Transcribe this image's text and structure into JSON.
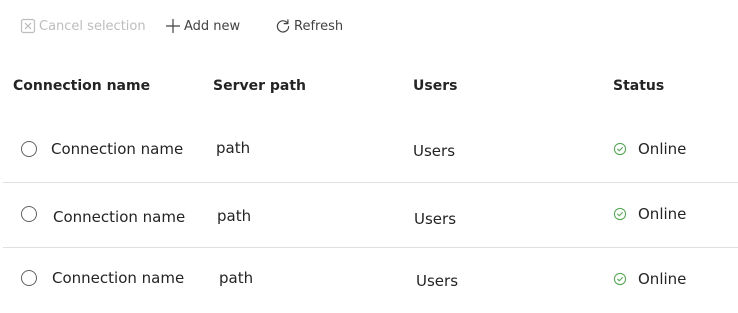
{
  "toolbar": {
    "cancel_label": "Cancel selection",
    "add_label": "Add new",
    "refresh_label": "Refresh"
  },
  "table": {
    "columns": [
      "Connection name",
      "Server path",
      "Users",
      "Status"
    ],
    "rows": [
      {
        "name": "Connection name",
        "path": "path",
        "users": "Users",
        "status": "Online"
      },
      {
        "name": "Connection name",
        "path": "path",
        "users": "Users",
        "status": "Online"
      },
      {
        "name": "Connection name",
        "path": "path",
        "users": "Users",
        "status": "Online"
      }
    ]
  },
  "colors": {
    "online": "#5aa85a",
    "disabled_text": "#bdbdbd",
    "divider": "#e0e0e0"
  },
  "icons": {
    "cancel": "dismiss-square-icon",
    "add": "add-icon",
    "refresh": "refresh-icon",
    "status": "checkmark-circle-icon"
  }
}
